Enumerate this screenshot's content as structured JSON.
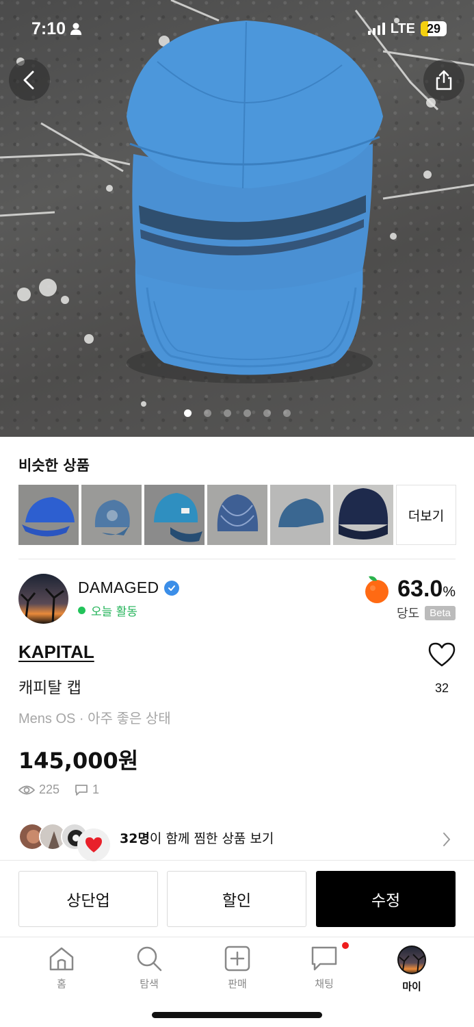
{
  "status_bar": {
    "time": "7:10",
    "network": "LTE",
    "battery": "29"
  },
  "gallery": {
    "photo_count": 6,
    "active_index": 0
  },
  "similar": {
    "title": "비슷한 상품",
    "more_label": "더보기",
    "items": [
      {
        "color": "#2d5fd0"
      },
      {
        "color": "#4f79a6"
      },
      {
        "color": "#2f8fc0"
      },
      {
        "color": "#3e5f94"
      },
      {
        "color": "#3a6791"
      },
      {
        "color": "#1e2a4c"
      }
    ]
  },
  "seller": {
    "name": "DAMAGED",
    "activity": "오늘 활동",
    "sweetness_value": "63.0",
    "sweetness_unit": "%",
    "sweetness_label": "당도",
    "beta_label": "Beta"
  },
  "product": {
    "brand": "KAPITAL",
    "name": "캐피탈 캡",
    "size": "Mens OS",
    "separator": "·",
    "condition": "아주 좋은 상태",
    "price": "145,000원",
    "views": "225",
    "comments": "1",
    "likes": "32"
  },
  "wishers": {
    "count": "32명",
    "text": "이 함께 찜한 상품 보기"
  },
  "actions": {
    "bump": "상단업",
    "discount": "할인",
    "edit": "수정"
  },
  "tabs": [
    {
      "label": "홈",
      "icon": "home-icon"
    },
    {
      "label": "탐색",
      "icon": "search-icon"
    },
    {
      "label": "판매",
      "icon": "plus-square-icon"
    },
    {
      "label": "채팅",
      "icon": "chat-icon"
    },
    {
      "label": "마이",
      "icon": "avatar"
    }
  ],
  "colors": {
    "accent_green": "#22b358",
    "verified_blue": "#3b8ee8",
    "badge_red": "#ee1d1d",
    "cap_blue": "#4a93d6"
  }
}
